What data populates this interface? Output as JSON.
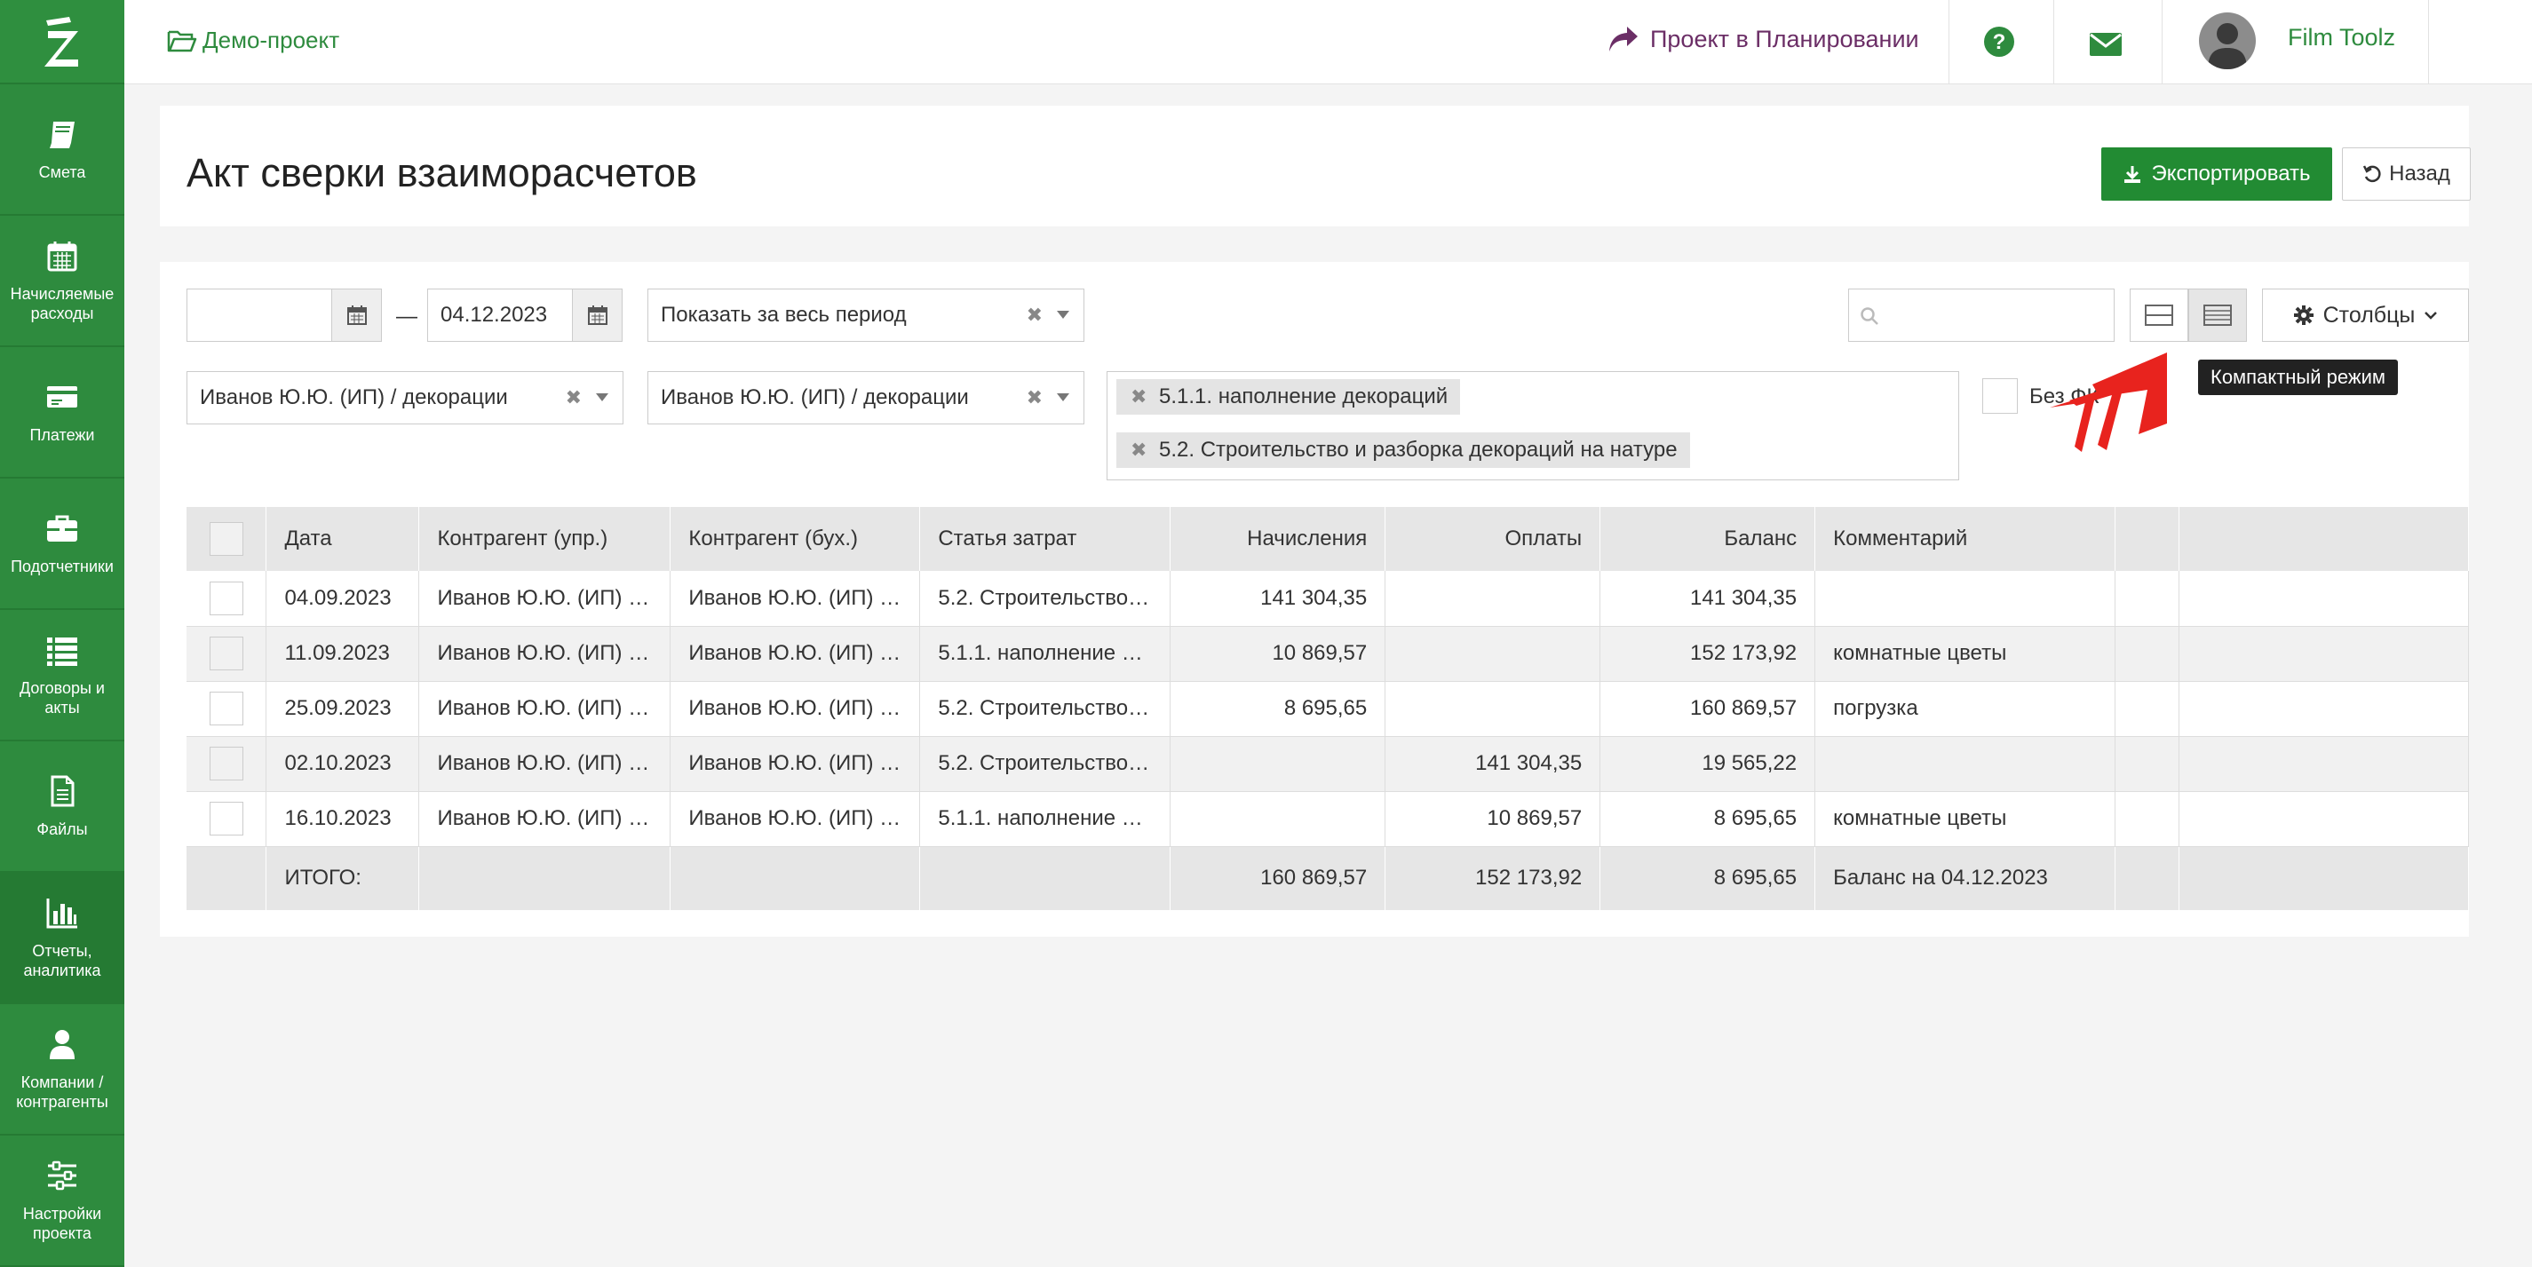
{
  "sidebar": {
    "items": [
      {
        "label": "Смета",
        "icon": "book-icon"
      },
      {
        "label": "Начисляемые расходы",
        "icon": "calendar-icon"
      },
      {
        "label": "Платежи",
        "icon": "credit-card-icon"
      },
      {
        "label": "Подотчетники",
        "icon": "briefcase-icon"
      },
      {
        "label": "Договоры и акты",
        "icon": "list-icon"
      },
      {
        "label": "Файлы",
        "icon": "file-icon"
      },
      {
        "label": "Отчеты, аналитика",
        "icon": "bar-chart-icon"
      },
      {
        "label": "Компании / контрагенты",
        "icon": "user-icon"
      },
      {
        "label": "Настройки проекта",
        "icon": "sliders-icon"
      }
    ],
    "active_index": 6
  },
  "topbar": {
    "project": "Демо-проект",
    "planning": "Проект в Планировании",
    "user": "Film Toolz",
    "lang": "RU"
  },
  "page": {
    "title": "Акт сверки взаиморасчетов",
    "export_label": "Экспортировать",
    "back_label": "Назад"
  },
  "filters": {
    "date_from": "",
    "date_to": "04.12.2023",
    "dash": "—",
    "period": "Показать за весь период",
    "counterparty_mgmt": "Иванов Ю.Ю. (ИП) / декорации",
    "counterparty_acc": "Иванов Ю.Ю. (ИП) / декорации",
    "tags": [
      "5.1.1. наполнение декораций",
      "5.2. Строительство и разборка декораций на натуре"
    ],
    "no_fk_label": "Без ФК",
    "search_placeholder": "",
    "columns_label": "Столбцы",
    "tooltip": "Компактный режим"
  },
  "table": {
    "headers": [
      "Дата",
      "Контрагент (упр.)",
      "Контрагент (бух.)",
      "Статья затрат",
      "Начисления",
      "Оплаты",
      "Баланс",
      "Комментарий"
    ],
    "rows": [
      {
        "date": "04.09.2023",
        "cp_mgmt": "Иванов Ю.Ю. (ИП) / декорации",
        "cp_acc": "Иванов Ю.Ю. (ИП) / декорации",
        "item": "5.2. Строительство и разборка декораций на натуре",
        "accrual": "141 304,35",
        "payment": "",
        "balance": "141 304,35",
        "comment": ""
      },
      {
        "date": "11.09.2023",
        "cp_mgmt": "Иванов Ю.Ю. (ИП) / декорации",
        "cp_acc": "Иванов Ю.Ю. (ИП) / декорации",
        "item": "5.1.1. наполнение декораций",
        "accrual": "10 869,57",
        "payment": "",
        "balance": "152 173,92",
        "comment": "комнатные цветы"
      },
      {
        "date": "25.09.2023",
        "cp_mgmt": "Иванов Ю.Ю. (ИП) / декорации",
        "cp_acc": "Иванов Ю.Ю. (ИП) / декорации",
        "item": "5.2. Строительство и разборка декораций на натуре",
        "accrual": "8 695,65",
        "payment": "",
        "balance": "160 869,57",
        "comment": "погрузка"
      },
      {
        "date": "02.10.2023",
        "cp_mgmt": "Иванов Ю.Ю. (ИП) / декорации",
        "cp_acc": "Иванов Ю.Ю. (ИП) / декорации",
        "item": "5.2. Строительство и разборка декораций на натуре",
        "accrual": "",
        "payment": "141 304,35",
        "balance": "19 565,22",
        "comment": ""
      },
      {
        "date": "16.10.2023",
        "cp_mgmt": "Иванов Ю.Ю. (ИП) / декорации",
        "cp_acc": "Иванов Ю.Ю. (ИП) / декорации",
        "item": "5.1.1. наполнение декораций",
        "accrual": "",
        "payment": "10 869,57",
        "balance": "8 695,65",
        "comment": "комнатные цветы"
      }
    ],
    "total": {
      "label": "ИТОГО:",
      "accrual": "160 869,57",
      "payment": "152 173,92",
      "balance": "8 695,65",
      "comment": "Баланс на 04.12.2023"
    }
  },
  "colors": {
    "brand": "#2e8b3e",
    "planning": "#6b2e66",
    "pointer": "#e8231e"
  }
}
